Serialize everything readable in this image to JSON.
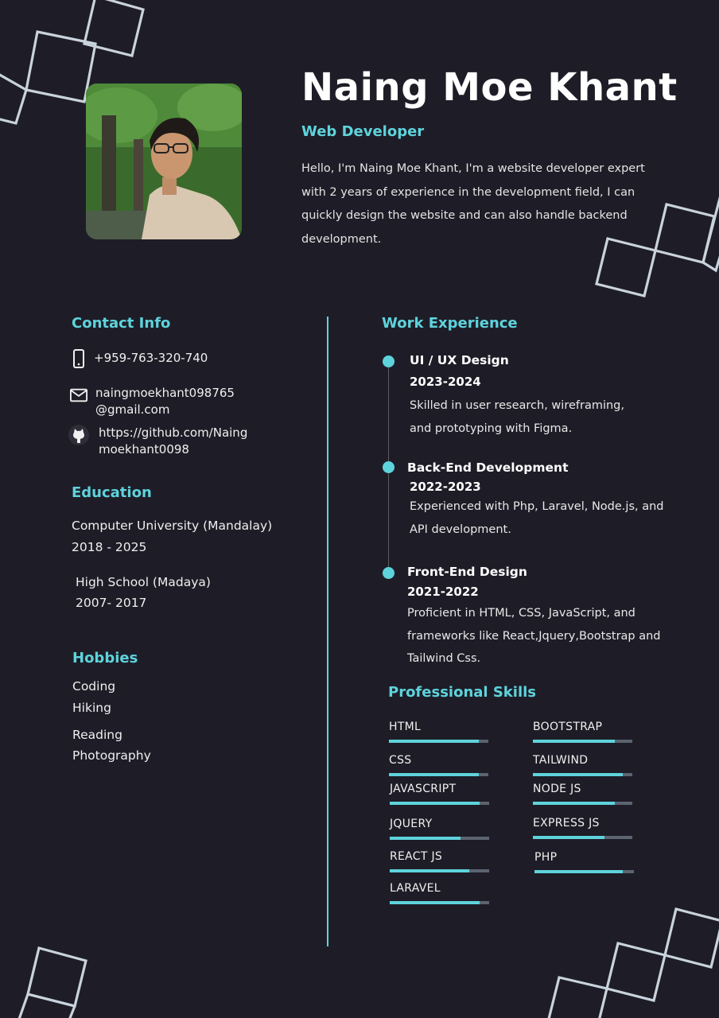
{
  "header": {
    "name": "Naing Moe Khant",
    "role": "Web Developer",
    "intro": "Hello, I'm Naing Moe Khant, I'm a website developer expert with 2 years of experience in the development field, I can quickly design the website and  can also handle backend development."
  },
  "contact": {
    "title": "Contact Info",
    "phone": "+959-763-320-740",
    "email": "naingmoekhant098765@gmail.com",
    "github": "https://github.com/Naingmoekhant0098"
  },
  "education": {
    "title": "Education",
    "items": [
      {
        "school": "Computer University (Mandalay)",
        "years": "2018 - 2025"
      },
      {
        "school": "High School (Madaya)",
        "years": "2007- 2017"
      }
    ]
  },
  "hobbies": {
    "title": "Hobbies",
    "items": [
      "Coding",
      "Hiking",
      "Reading",
      "Photography"
    ]
  },
  "work": {
    "title": "Work Experience",
    "items": [
      {
        "title": "UI / UX Design",
        "years": "2023-2024",
        "desc": "Skilled in user research, wireframing, and prototyping with Figma."
      },
      {
        "title": "Back-End Development",
        "years": "2022-2023",
        "desc": "Experienced with Php, Laravel, Node.js, and API development."
      },
      {
        "title": "Front-End  Design",
        "years": "2021-2022",
        "desc": "Proficient in HTML, CSS, JavaScript, and frameworks like React,Jquery,Bootstrap and Tailwind Css."
      }
    ]
  },
  "skills": {
    "title": "Professional Skills",
    "items": [
      {
        "name": "HTML",
        "level": 0.9
      },
      {
        "name": "BOOTSTRAP",
        "level": 0.82
      },
      {
        "name": "CSS",
        "level": 0.9
      },
      {
        "name": "TAILWIND",
        "level": 0.9
      },
      {
        "name": "JAVASCRIPT",
        "level": 0.9
      },
      {
        "name": "NODE JS",
        "level": 0.82
      },
      {
        "name": "JQUERY",
        "level": 0.71
      },
      {
        "name": "EXPRESS JS",
        "level": 0.72
      },
      {
        "name": "REACT JS",
        "level": 0.8
      },
      {
        "name": "PHP",
        "level": 0.89
      },
      {
        "name": "LARAVEL",
        "level": 0.9
      }
    ]
  },
  "colors": {
    "background": "#1e1d27",
    "accent": "#5ed3dc",
    "bar_track": "#5b6470",
    "decor_lines": "#c9d3dd"
  },
  "icons": [
    "phone-icon",
    "email-icon",
    "github-icon"
  ]
}
